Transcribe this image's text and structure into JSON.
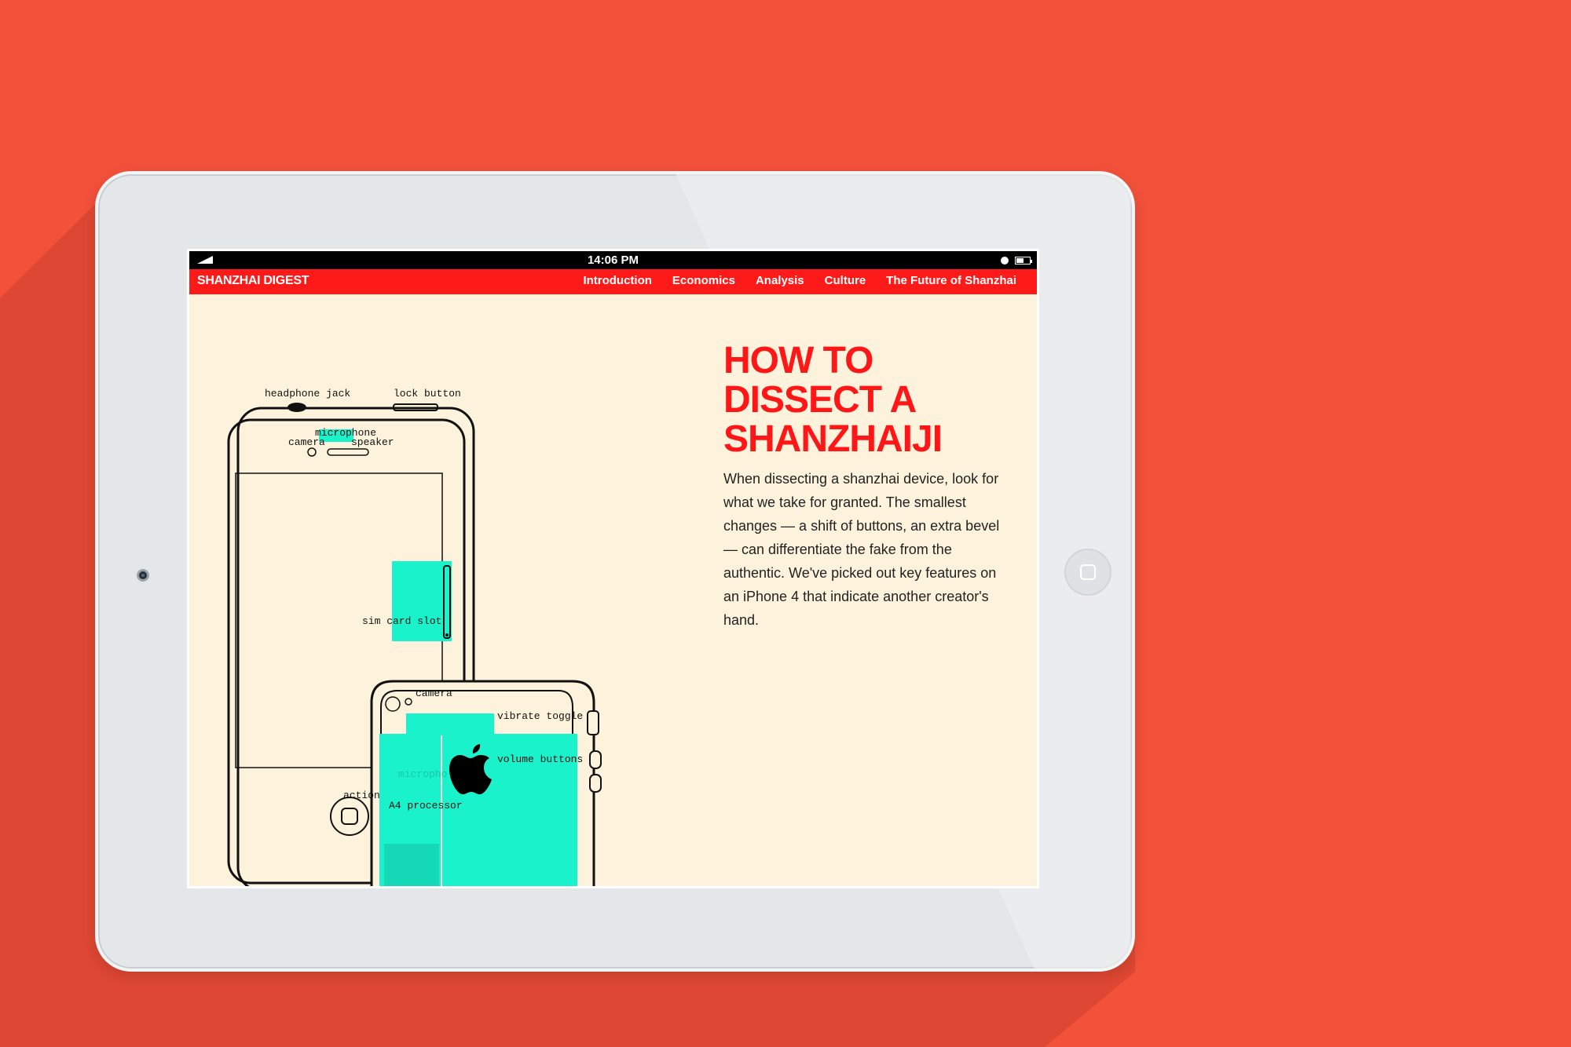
{
  "status_bar": {
    "time": "14:06 PM"
  },
  "nav": {
    "brand": "SHANZHAI DIGEST",
    "items": [
      "Introduction",
      "Economics",
      "Analysis",
      "Culture",
      "The Future of Shanzhai"
    ]
  },
  "article": {
    "headline": [
      "HOW TO",
      "DISSECT A",
      "SHANZHAIJI"
    ],
    "body": "When dissecting a shanzhai device, look for what we take for granted. The smallest changes — a shift of buttons, an extra bevel — can differentiate the fake from the authentic. We've picked out key features on an iPhone 4 that indicate another creator's hand."
  },
  "diagram": {
    "labels": {
      "headphone_jack": "headphone jack",
      "lock_button": "lock button",
      "microphone_front": "microphone",
      "camera_front": "camera",
      "speaker": "speaker",
      "sim_card_slot": "sim card slot",
      "camera_back": "camera",
      "vibrate_toggle": "vibrate toggle",
      "volume_buttons": "volume buttons",
      "microphone_back": "micropho",
      "action": "action",
      "a4_processor": "A4 processor"
    }
  },
  "colors": {
    "background": "#f2513a",
    "nav_red": "#ff1a1a",
    "headline_red": "#ff1616",
    "paper": "#fdf3dc",
    "highlight": "#1af2cc"
  }
}
